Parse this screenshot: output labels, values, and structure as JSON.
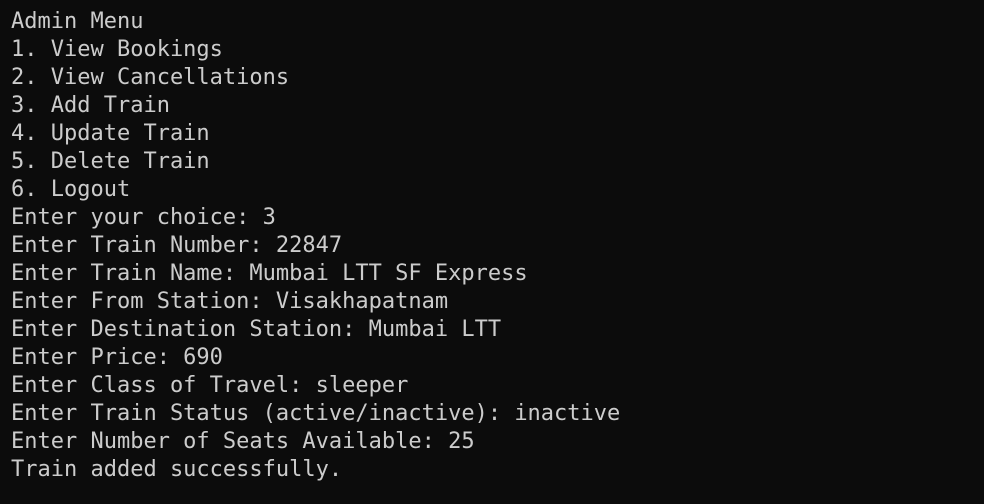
{
  "terminal": {
    "lines": [
      "Admin Menu",
      "1. View Bookings",
      "2. View Cancellations",
      "3. Add Train",
      "4. Update Train",
      "5. Delete Train",
      "6. Logout",
      "Enter your choice: 3",
      "Enter Train Number: 22847",
      "Enter Train Name: Mumbai LTT SF Express",
      "Enter From Station: Visakhapatnam",
      "Enter Destination Station: Mumbai LTT",
      "Enter Price: 690",
      "Enter Class of Travel: sleeper",
      "Enter Train Status (active/inactive): inactive",
      "Enter Number of Seats Available: 25",
      "Train added successfully."
    ]
  },
  "colors": {
    "background": "#0c0c0c",
    "foreground": "#cccccc"
  }
}
